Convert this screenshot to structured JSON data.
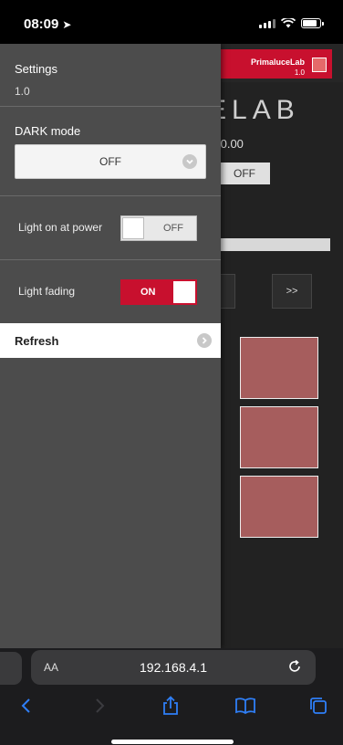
{
  "status_bar": {
    "time": "08:09",
    "location_icon": "location-arrow-icon"
  },
  "background_app": {
    "brand_name": "PrimaluceLab",
    "brand_version": "1.0",
    "logo_text": "ELAB",
    "value_text": ".0.00",
    "off_button": "OFF",
    "next_button": ">>"
  },
  "panel": {
    "title": "Settings",
    "version": "1.0",
    "dark_mode": {
      "label": "DARK mode",
      "value": "OFF"
    },
    "light_on_power": {
      "label": "Light on at power",
      "state": "OFF"
    },
    "light_fading": {
      "label": "Light fading",
      "state": "ON"
    },
    "refresh": {
      "label": "Refresh"
    }
  },
  "safari": {
    "aa_label": "AA",
    "url": "192.168.4.1"
  },
  "colors": {
    "accent": "#c8102e",
    "panel": "#4c4c4c",
    "tile": "#a65d5d"
  }
}
